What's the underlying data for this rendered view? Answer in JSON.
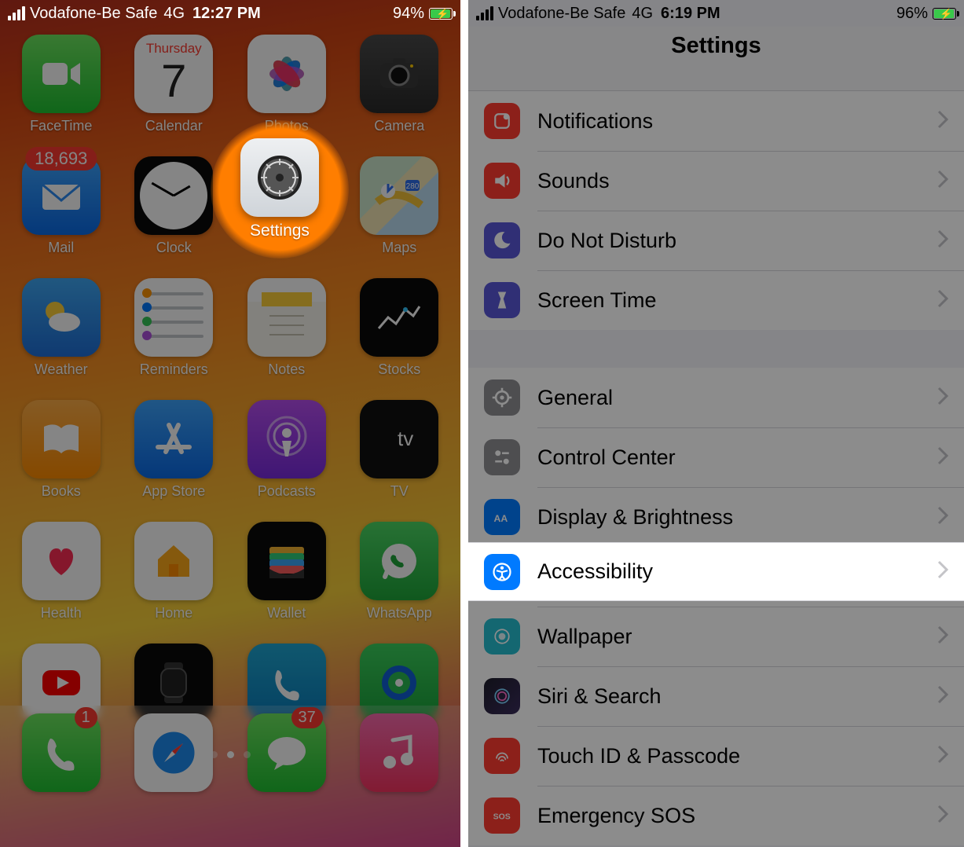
{
  "left": {
    "status": {
      "carrier": "Vodafone-Be Safe",
      "network": "4G",
      "time": "12:27 PM",
      "battery_pct": "94%"
    },
    "highlight_app": "Settings",
    "calendar_day_label": "Thursday",
    "calendar_day_num": "7",
    "apps": {
      "r1": [
        "FaceTime",
        "Calendar",
        "Photos",
        "Camera"
      ],
      "r2": [
        "Mail",
        "Clock",
        "Settings",
        "Maps"
      ],
      "r3": [
        "Weather",
        "Reminders",
        "Notes",
        "Stocks"
      ],
      "r4": [
        "Books",
        "App Store",
        "Podcasts",
        "TV"
      ],
      "r5": [
        "Health",
        "Home",
        "Wallet",
        "WhatsApp"
      ],
      "r6": [
        "YouTube",
        "Watch",
        "Truecaller",
        "Find My"
      ]
    },
    "badges": {
      "mail": "18,693",
      "phone": "1",
      "messages": "37"
    },
    "dock": [
      "Phone",
      "Safari",
      "Messages",
      "Music"
    ]
  },
  "right": {
    "status": {
      "carrier": "Vodafone-Be Safe",
      "network": "4G",
      "time": "6:19 PM",
      "battery_pct": "96%"
    },
    "title": "Settings",
    "rows": {
      "notifications": "Notifications",
      "sounds": "Sounds",
      "dnd": "Do Not Disturb",
      "screen_time": "Screen Time",
      "general": "General",
      "control_center": "Control Center",
      "display": "Display & Brightness",
      "accessibility": "Accessibility",
      "wallpaper": "Wallpaper",
      "siri": "Siri & Search",
      "touchid": "Touch ID & Passcode",
      "sos": "Emergency SOS"
    }
  }
}
